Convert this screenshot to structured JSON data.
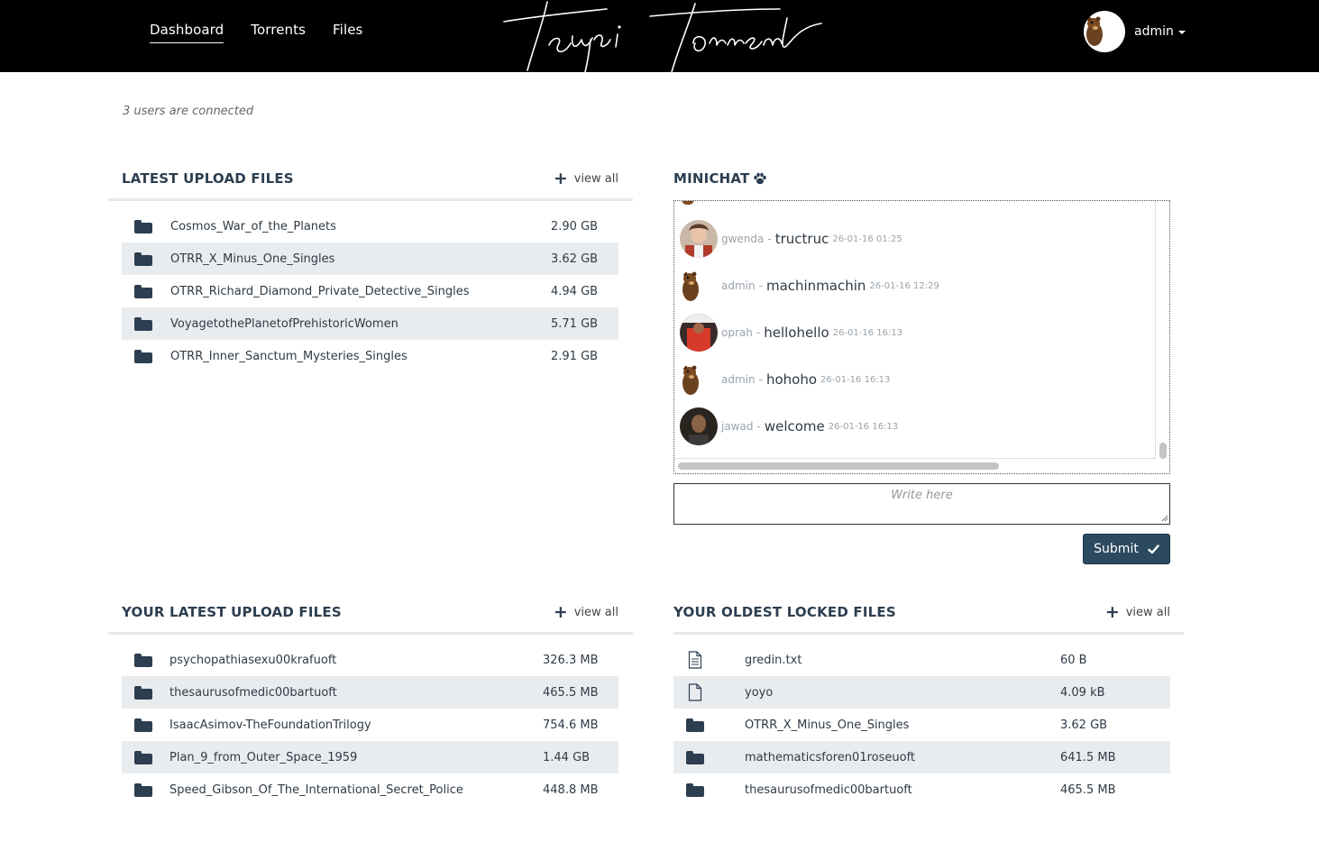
{
  "nav": {
    "links": [
      "Dashboard",
      "Torrents",
      "Files"
    ],
    "logo_text": "Teurpi Torrent",
    "user": "admin"
  },
  "status": {
    "connected": "3 users are connected"
  },
  "latest_uploads": {
    "title": "LATEST UPLOAD FILES",
    "view_all": "view all",
    "files": [
      {
        "name": "Cosmos_War_of_the_Planets",
        "size": "2.90 GB",
        "icon": "folder-icon"
      },
      {
        "name": "OTRR_X_Minus_One_Singles",
        "size": "3.62 GB",
        "icon": "folder-icon"
      },
      {
        "name": "OTRR_Richard_Diamond_Private_Detective_Singles",
        "size": "4.94 GB",
        "icon": "folder-icon"
      },
      {
        "name": "VoyagetothePlanetofPrehistoricWomen",
        "size": "5.71 GB",
        "icon": "folder-icon"
      },
      {
        "name": "OTRR_Inner_Sanctum_Mysteries_Singles",
        "size": "2.91 GB",
        "icon": "folder-icon"
      }
    ]
  },
  "minichat": {
    "title": "MINICHAT",
    "title_icon": "paw-icon",
    "messages": [
      {
        "user": "gwenda",
        "text": "tructruc",
        "time": "26-01-16 01:25"
      },
      {
        "user": "admin",
        "text": "machinmachin",
        "time": "26-01-16 12:29"
      },
      {
        "user": "oprah",
        "text": "hellohello",
        "time": "26-01-16 16:13"
      },
      {
        "user": "admin",
        "text": "hohoho",
        "time": "26-01-16 16:13"
      },
      {
        "user": "jawad",
        "text": "welcome",
        "time": "26-01-16 16:13"
      }
    ],
    "separator": " - ",
    "input_placeholder": "Write here",
    "submit_label": "Submit"
  },
  "your_latest": {
    "title": "YOUR LATEST UPLOAD FILES",
    "view_all": "view all",
    "files": [
      {
        "name": "psychopathiasexu00krafuoft",
        "size": "326.3 MB",
        "icon": "folder-icon"
      },
      {
        "name": "thesaurusofmedic00bartuoft",
        "size": "465.5 MB",
        "icon": "folder-icon"
      },
      {
        "name": "IsaacAsimov-TheFoundationTrilogy",
        "size": "754.6 MB",
        "icon": "folder-icon"
      },
      {
        "name": "Plan_9_from_Outer_Space_1959",
        "size": "1.44 GB",
        "icon": "folder-icon"
      },
      {
        "name": "Speed_Gibson_Of_The_International_Secret_Police",
        "size": "448.8 MB",
        "icon": "folder-icon"
      }
    ]
  },
  "oldest_locked": {
    "title": "YOUR OLDEST LOCKED FILES",
    "view_all": "view all",
    "files": [
      {
        "name": "gredin.txt",
        "size": "60 B",
        "icon": "text-file-icon"
      },
      {
        "name": "yoyo",
        "size": "4.09 kB",
        "icon": "file-icon"
      },
      {
        "name": "OTRR_X_Minus_One_Singles",
        "size": "3.62 GB",
        "icon": "folder-icon"
      },
      {
        "name": "mathematicsforen01roseuoft",
        "size": "641.5 MB",
        "icon": "folder-icon"
      },
      {
        "name": "thesaurusofmedic00bartuoft",
        "size": "465.5 MB",
        "icon": "folder-icon"
      }
    ]
  }
}
